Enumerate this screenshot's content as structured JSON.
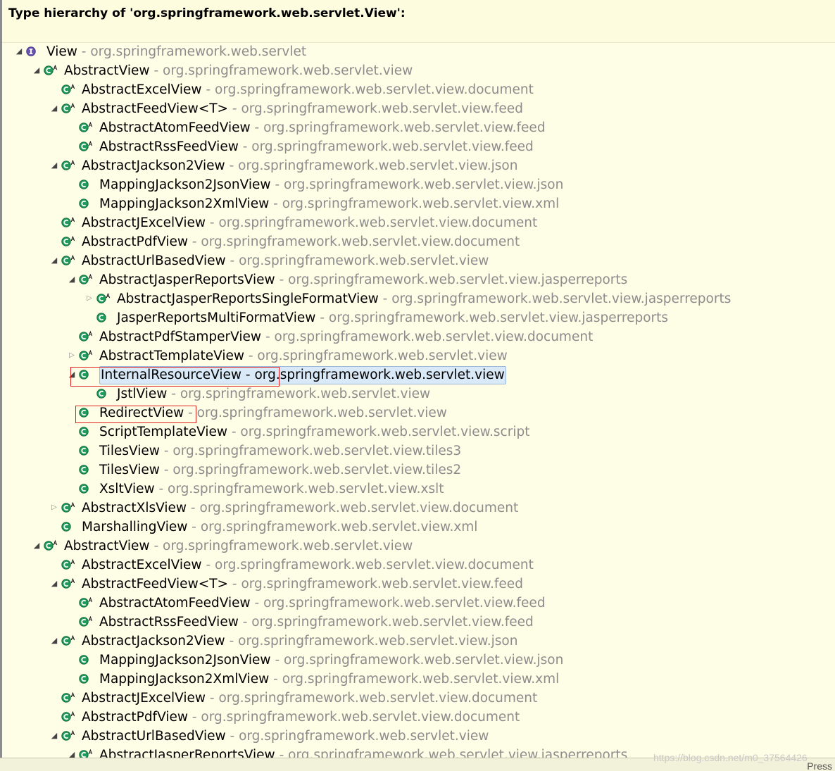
{
  "title": "Type hierarchy of 'org.springframework.web.servlet.View':",
  "status": {
    "hint": "Press"
  },
  "watermark": "https://blog.csdn.net/m0_37564426",
  "colors": {
    "background": "#fefde6",
    "selection": "#d9e9f8",
    "annotation": "#e02020",
    "package_text": "#8c8c8c",
    "class_icon": "#1f9b5a",
    "interface_icon": "#6a55b3"
  },
  "tree": [
    {
      "name": "View",
      "pkg": "org.springframework.web.servlet",
      "icon": "interface-icon",
      "twisty": "expanded"
    },
    {
      "name": "AbstractView",
      "pkg": "org.springframework.web.servlet.view",
      "icon": "abstract-class-icon",
      "twisty": "expanded"
    },
    {
      "name": "AbstractExcelView",
      "pkg": "org.springframework.web.servlet.view.document",
      "icon": "abstract-class-icon",
      "twisty": "none"
    },
    {
      "name": "AbstractFeedView<T>",
      "pkg": "org.springframework.web.servlet.view.feed",
      "icon": "abstract-class-icon",
      "twisty": "expanded"
    },
    {
      "name": "AbstractAtomFeedView",
      "pkg": "org.springframework.web.servlet.view.feed",
      "icon": "abstract-class-icon",
      "twisty": "none"
    },
    {
      "name": "AbstractRssFeedView",
      "pkg": "org.springframework.web.servlet.view.feed",
      "icon": "abstract-class-icon",
      "twisty": "none"
    },
    {
      "name": "AbstractJackson2View",
      "pkg": "org.springframework.web.servlet.view.json",
      "icon": "abstract-class-icon",
      "twisty": "expanded"
    },
    {
      "name": "MappingJackson2JsonView",
      "pkg": "org.springframework.web.servlet.view.json",
      "icon": "class-icon",
      "twisty": "none"
    },
    {
      "name": "MappingJackson2XmlView",
      "pkg": "org.springframework.web.servlet.view.xml",
      "icon": "class-icon",
      "twisty": "none"
    },
    {
      "name": "AbstractJExcelView",
      "pkg": "org.springframework.web.servlet.view.document",
      "icon": "abstract-class-icon",
      "twisty": "none"
    },
    {
      "name": "AbstractPdfView",
      "pkg": "org.springframework.web.servlet.view.document",
      "icon": "abstract-class-icon",
      "twisty": "none"
    },
    {
      "name": "AbstractUrlBasedView",
      "pkg": "org.springframework.web.servlet.view",
      "icon": "abstract-class-icon",
      "twisty": "expanded"
    },
    {
      "name": "AbstractJasperReportsView",
      "pkg": "org.springframework.web.servlet.view.jasperreports",
      "icon": "abstract-class-icon",
      "twisty": "expanded"
    },
    {
      "name": "AbstractJasperReportsSingleFormatView",
      "pkg": "org.springframework.web.servlet.view.jasperreports",
      "icon": "abstract-class-icon",
      "twisty": "collapsed"
    },
    {
      "name": "JasperReportsMultiFormatView",
      "pkg": "org.springframework.web.servlet.view.jasperreports",
      "icon": "class-icon",
      "twisty": "none"
    },
    {
      "name": "AbstractPdfStamperView",
      "pkg": "org.springframework.web.servlet.view.document",
      "icon": "abstract-class-icon",
      "twisty": "none"
    },
    {
      "name": "AbstractTemplateView",
      "pkg": "org.springframework.web.servlet.view",
      "icon": "abstract-class-icon",
      "twisty": "collapsed"
    },
    {
      "name": "InternalResourceView",
      "pkg": "org.springframework.web.servlet.view",
      "icon": "class-icon",
      "twisty": "expanded",
      "selected": true
    },
    {
      "name": "JstlView",
      "pkg": "org.springframework.web.servlet.view",
      "icon": "class-icon",
      "twisty": "none"
    },
    {
      "name": "RedirectView",
      "pkg": "org.springframework.web.servlet.view",
      "icon": "class-icon",
      "twisty": "none"
    },
    {
      "name": "ScriptTemplateView",
      "pkg": "org.springframework.web.servlet.view.script",
      "icon": "class-icon",
      "twisty": "none"
    },
    {
      "name": "TilesView",
      "pkg": "org.springframework.web.servlet.view.tiles3",
      "icon": "class-icon",
      "twisty": "none"
    },
    {
      "name": "TilesView",
      "pkg": "org.springframework.web.servlet.view.tiles2",
      "icon": "class-icon",
      "twisty": "none"
    },
    {
      "name": "XsltView",
      "pkg": "org.springframework.web.servlet.view.xslt",
      "icon": "class-icon",
      "twisty": "none"
    },
    {
      "name": "AbstractXlsView",
      "pkg": "org.springframework.web.servlet.view.document",
      "icon": "abstract-class-icon",
      "twisty": "collapsed"
    },
    {
      "name": "MarshallingView",
      "pkg": "org.springframework.web.servlet.view.xml",
      "icon": "class-icon",
      "twisty": "none"
    },
    {
      "name": "AbstractView",
      "pkg": "org.springframework.web.servlet.view",
      "icon": "abstract-class-icon",
      "twisty": "expanded"
    },
    {
      "name": "AbstractExcelView",
      "pkg": "org.springframework.web.servlet.view.document",
      "icon": "abstract-class-icon",
      "twisty": "none"
    },
    {
      "name": "AbstractFeedView<T>",
      "pkg": "org.springframework.web.servlet.view.feed",
      "icon": "abstract-class-icon",
      "twisty": "expanded"
    },
    {
      "name": "AbstractAtomFeedView",
      "pkg": "org.springframework.web.servlet.view.feed",
      "icon": "abstract-class-icon",
      "twisty": "none"
    },
    {
      "name": "AbstractRssFeedView",
      "pkg": "org.springframework.web.servlet.view.feed",
      "icon": "abstract-class-icon",
      "twisty": "none"
    },
    {
      "name": "AbstractJackson2View",
      "pkg": "org.springframework.web.servlet.view.json",
      "icon": "abstract-class-icon",
      "twisty": "expanded"
    },
    {
      "name": "MappingJackson2JsonView",
      "pkg": "org.springframework.web.servlet.view.json",
      "icon": "class-icon",
      "twisty": "none"
    },
    {
      "name": "MappingJackson2XmlView",
      "pkg": "org.springframework.web.servlet.view.xml",
      "icon": "class-icon",
      "twisty": "none"
    },
    {
      "name": "AbstractJExcelView",
      "pkg": "org.springframework.web.servlet.view.document",
      "icon": "abstract-class-icon",
      "twisty": "none"
    },
    {
      "name": "AbstractPdfView",
      "pkg": "org.springframework.web.servlet.view.document",
      "icon": "abstract-class-icon",
      "twisty": "none"
    },
    {
      "name": "AbstractUrlBasedView",
      "pkg": "org.springframework.web.servlet.view",
      "icon": "abstract-class-icon",
      "twisty": "expanded"
    },
    {
      "name": "AbstractJasperReportsView",
      "pkg": "org.springframework.web.servlet.view.jasperreports",
      "icon": "abstract-class-icon",
      "twisty": "expanded"
    }
  ]
}
